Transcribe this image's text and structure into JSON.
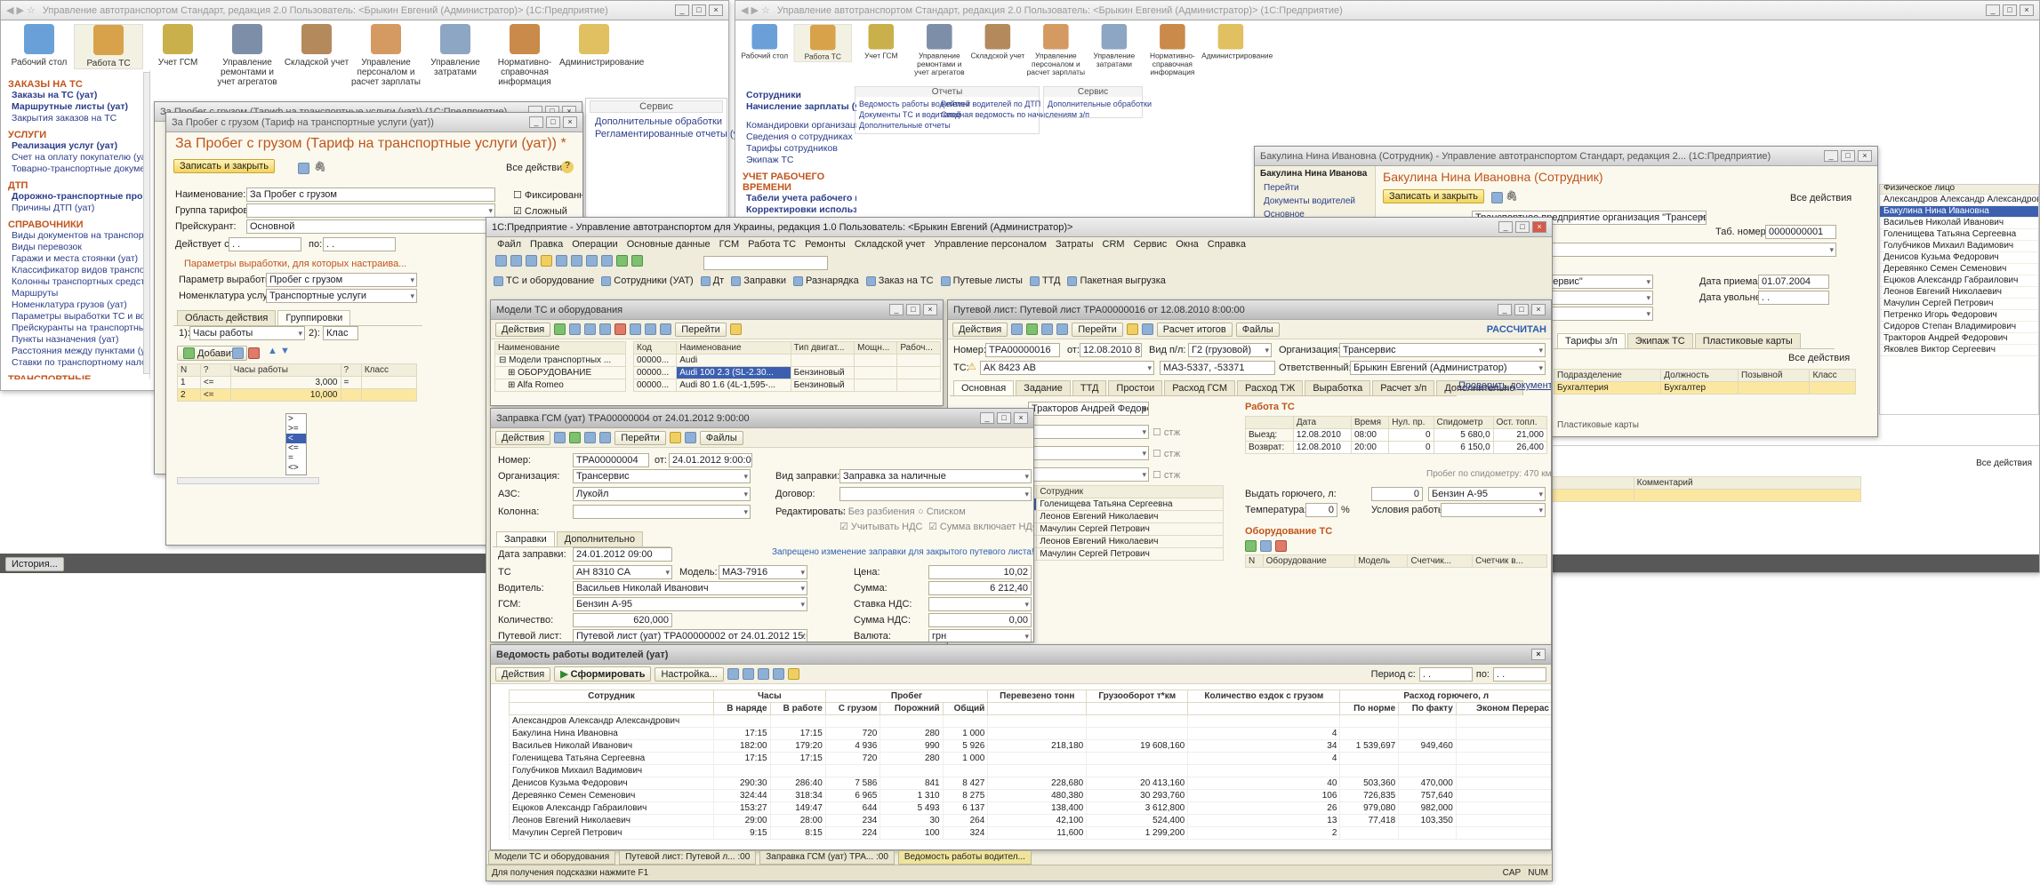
{
  "left_app": {
    "title": "Управление автотранспортом Стандарт, редакция 2.0  Пользователь: <Брыкин Евгений (Администратор)> (1С:Предприятие)",
    "sections": [
      {
        "label": "Рабочий стол",
        "icon": "desktop-icon"
      },
      {
        "label": "Работа ТС",
        "icon": "truck-icon"
      },
      {
        "label": "Учет ГСМ",
        "icon": "fuel-barrels-icon"
      },
      {
        "label": "Управление ремонтами и учет агрегатов",
        "icon": "tools-icon"
      },
      {
        "label": "Складской учет",
        "icon": "warehouse-icon"
      },
      {
        "label": "Управление персоналом и расчет зарплаты",
        "icon": "worker-icon"
      },
      {
        "label": "Управление затратами",
        "icon": "calculator-icon"
      },
      {
        "label": "Нормативно-справочная информация",
        "icon": "books-icon"
      },
      {
        "label": "Администрирование",
        "icon": "database-icon"
      }
    ],
    "nav": [
      {
        "type": "section",
        "text": "Заказы на ТС"
      },
      {
        "type": "bold",
        "text": "Заказы на ТС (уат)"
      },
      {
        "type": "bold",
        "text": "Маршрутные листы (уат)"
      },
      {
        "type": "link",
        "text": "Закрытия заказов на ТС"
      },
      {
        "type": "section",
        "text": "Услуги"
      },
      {
        "type": "bold",
        "text": "Реализация услуг (уат)"
      },
      {
        "type": "link",
        "text": "Счет на оплату покупателю (уат)"
      },
      {
        "type": "link",
        "text": "Товарно-транспортные документы (уат)"
      },
      {
        "type": "section",
        "text": "ДТП"
      },
      {
        "type": "bold",
        "text": "Дорожно-транспортные происшест..."
      },
      {
        "type": "link",
        "text": "Причины ДТП (уат)"
      },
      {
        "type": "section",
        "text": "Справочники"
      },
      {
        "type": "link",
        "text": "Виды документов на транспортные средст..."
      },
      {
        "type": "link",
        "text": "Виды перевозок"
      },
      {
        "type": "link",
        "text": "Гаражи и места стоянки (уат)"
      },
      {
        "type": "link",
        "text": "Классификатор видов транспортных средст..."
      },
      {
        "type": "link",
        "text": "Колонны транспортных средств (уат)"
      },
      {
        "type": "link",
        "text": "Маршруты"
      },
      {
        "type": "link",
        "text": "Номенклатура грузов (уат)"
      },
      {
        "type": "link",
        "text": "Параметры выработки ТС и водителей (уат)"
      },
      {
        "type": "link",
        "text": "Прейскуранты на транспортные услуги (уат)"
      },
      {
        "type": "link",
        "text": "Пункты назначения (уат)"
      },
      {
        "type": "link",
        "text": "Расстояния между пунктами (уат)"
      },
      {
        "type": "link",
        "text": "Ставки по транспортному налогу (уат)"
      },
      {
        "type": "section",
        "text": "Транспортные средства"
      },
      {
        "type": "bold",
        "text": "Транспортные средства и оборуд..."
      },
      {
        "type": "bold",
        "text": "Модели транспортных средств и о..."
      },
      {
        "type": "link",
        "text": "Документы ТС (уат)"
      }
    ],
    "history_btn": "История..."
  },
  "tariff_bg": {
    "title": "За Пробег с грузом (Тариф на транспортные услуги (уат)) (1С:Предприятие)"
  },
  "service_panel": {
    "header": "Сервис",
    "links": [
      "Дополнительные обработки",
      "Регламентированные отчеты (уат)"
    ]
  },
  "tariff": {
    "title": "За Пробег с грузом (Тариф на транспортные услуги (уат))",
    "heading": "За Пробег с грузом (Тариф на транспортные услуги (уат)) *",
    "save_close": "Записать и закрыть",
    "all_actions": "Все действия",
    "name_label": "Наименование:",
    "name_value": "За Пробег с грузом",
    "fixed": "Фиксированный",
    "complex": "Сложный",
    "group_label": "Группа тарифов:",
    "price_label": "Прейскурант:",
    "price_value": "Основной",
    "acts_label": "Действует с:",
    "acts_from": " .  .    ",
    "acts_to_label": "по:",
    "acts_to": " .  .    ",
    "params_header": "Параметры выработки, для которых настраива...",
    "param_label": "Параметр выработки:",
    "param_value": "Пробег с грузом",
    "nomen_label": "Номенклатура услуги:",
    "nomen_value": "Транспортные услуги",
    "tab1": "Область действия",
    "tab2": "Группировки",
    "row1_label": "1):",
    "row1_value": "Часы работы",
    "row2_label": "2):",
    "row2_value": "Клас",
    "add_btn": "Добавить",
    "cols": [
      "N",
      "?",
      "Часы работы",
      "?",
      "Класс"
    ],
    "rows": [
      [
        "1",
        "<=",
        "3,000",
        "="
      ],
      [
        "2",
        "<=",
        "10,000",
        ""
      ]
    ],
    "ops": [
      ">",
      ">=",
      "<",
      "<=",
      "=",
      "<>"
    ]
  },
  "right_app": {
    "title": "Управление автотранспортом Стандарт, редакция 2.0  Пользователь: <Брыкин Евгений (Администратор)> (1С:Предприятие)",
    "sections": [
      {
        "label": "Рабочий стол",
        "icon": "desktop-icon"
      },
      {
        "label": "Работа ТС",
        "icon": "truck-icon"
      },
      {
        "label": "Учет ГСМ",
        "icon": "fuel-barrels-icon"
      },
      {
        "label": "Управление ремонтами и учет агрегатов",
        "icon": "tools-icon"
      },
      {
        "label": "Складской учет",
        "icon": "warehouse-icon"
      },
      {
        "label": "Управление персоналом и расчет зарплаты",
        "icon": "worker-icon"
      },
      {
        "label": "Управление затратами",
        "icon": "calculator-icon"
      },
      {
        "label": "Нормативно-справочная информация",
        "icon": "books-icon"
      },
      {
        "label": "Администрирование",
        "icon": "database-icon"
      }
    ],
    "nav": [
      {
        "type": "bold",
        "text": "Сотрудники"
      },
      {
        "type": "bold",
        "text": "Начисление зарплаты (уат)"
      },
      {
        "type": "gap",
        "text": ""
      },
      {
        "type": "link",
        "text": "Командировки организаций"
      },
      {
        "type": "link",
        "text": "Сведения о сотрудниках"
      },
      {
        "type": "link",
        "text": "Тарифы сотрудников"
      },
      {
        "type": "link",
        "text": "Экипаж ТС"
      },
      {
        "type": "section",
        "text": "Учет рабочего времени"
      },
      {
        "type": "bold",
        "text": "Табели учета рабочего времени ..."
      },
      {
        "type": "bold",
        "text": "Корректировки использования ..."
      }
    ],
    "reports_header": "Отчеты",
    "reports": [
      "Ведомость работы водителей",
      "Рейтинг водителей по ДТП",
      "Документы ТС и водителей",
      "Сводная ведомость по начислениям з/п",
      "Дополнительные отчеты"
    ],
    "service_header": "Сервис",
    "service_links": [
      "Дополнительные обработки"
    ]
  },
  "employee": {
    "title": "Бакулина Нина Ивановна (Сотрудник) - Управление автотранспортом Стандарт, редакция 2... (1С:Предприятие)",
    "side_header": "Бакулина Нина Иванова",
    "side_links": [
      "Перейти",
      "Документы водителей",
      "Основное"
    ],
    "heading": "Бакулина Нина Ивановна (Сотрудник)",
    "save_close": "Записать и закрыть",
    "all_actions": "Все действия",
    "org_value": "Транспортное предприятие организация \"Трансервис\"",
    "tab_label": "Таб. номер:",
    "tab_value": "0000000001",
    "org2_value": "Компания \"Трансервис\"",
    "hire_label": "Дата приема:",
    "hire_value": "01.07.2004",
    "fire_label": "Дата увольнения:",
    "fire_value": " .  .    ",
    "tabs": [
      "Тарифы з/п",
      "Экипаж ТС",
      "Пластиковые карты"
    ],
    "cols": [
      "Подразделение",
      "Должность",
      "Позывной",
      "Класс"
    ],
    "row": [
      "Бухгалтерия",
      "Бухгалтер",
      "",
      ""
    ],
    "plastic_header": "Пластиковые карты",
    "plastic_cols": [
      "",
      "График работы",
      "Класс",
      "Позывной",
      "Комментарий"
    ]
  },
  "employee_list": {
    "header": "Физическое лицо",
    "names": [
      "Александров Александр Александрович",
      "Бакулина Нина Ивановна",
      "Васильев Николай Иванович",
      "Голенищева Татьяна Сергеевна",
      "Голубчиков Михаил Вадимович",
      "Денисов Кузьма Федорович",
      "Деревянко Семен Семенович",
      "Ецюков Александр Габраилович",
      "Леонов Евгений Николаевич",
      "Мачулин Сергей Петрович",
      "Петренко Игорь Федорович",
      "Сидоров Степан Владимирович",
      "Тракторов Андрей Федорович",
      "Яковлев Виктор Сергеевич"
    ],
    "selected": 1,
    "all_actions": "Все действия"
  },
  "main": {
    "title": "1С:Предприятие - Управление автотранспортом для Украины, редакция 1.0    Пользователь: <Брыкин Евгений (Администратор)>",
    "menu": [
      "Файл",
      "Правка",
      "Операции",
      "Основные данные",
      "ГСМ",
      "Работа ТС",
      "Ремонты",
      "Складской учет",
      "Управление персоналом",
      "Затраты",
      "CRM",
      "Сервис",
      "Окна",
      "Справка"
    ],
    "quick": [
      {
        "label": "ТС и оборудование",
        "icon": "truck-small-icon"
      },
      {
        "label": "Сотрудники (УАТ)",
        "icon": "people-icon"
      },
      {
        "label": "Дт",
        "icon": "debit-icon"
      },
      {
        "label": "Заправки",
        "icon": "fuel-pump-icon"
      },
      {
        "label": "Разнарядка",
        "icon": "schedule-icon"
      },
      {
        "label": "Заказ на ТС",
        "icon": "order-icon"
      },
      {
        "label": "Путевые листы",
        "icon": "waybill-icon"
      },
      {
        "label": "ТТД",
        "icon": "ttd-icon"
      },
      {
        "label": "Пакетная выгрузка",
        "icon": "export-icon"
      }
    ],
    "status_hint": "Для получения подсказки нажмите F1",
    "status_caps": "CAP",
    "status_num": "NUM",
    "taskbar": [
      "Модели ТС и оборудования",
      "Путевой лист: Путевой л... :00",
      "Заправка ГСМ (уат) ТРА... :00",
      "Ведомость работы водител..."
    ]
  },
  "models": {
    "title": "Модели ТС и оборудования",
    "actions": "Действия",
    "goto": "Перейти",
    "tree_header": "Наименование",
    "tree": [
      "Модели транспортных ...",
      "ОБОРУДОВАНИЕ",
      "Alfa Romeo"
    ],
    "cols": [
      "Код",
      "Наименование",
      "Тип двигат...",
      "Мощн...",
      "Рабоч..."
    ],
    "rows": [
      [
        "00000...",
        "Audi",
        "",
        "",
        ""
      ],
      [
        "00000...",
        "Audi 100 2.3 (SL-2.30...",
        "Бензиновый",
        "",
        ""
      ],
      [
        "00000...",
        "Audi 80 1.6 (4L-1,595-...",
        "Бензиновый",
        "",
        ""
      ]
    ]
  },
  "waybill": {
    "title": "Путевой лист: Путевой лист ТРА00000016 от 12.08.2010 8:00:00",
    "actions": "Действия",
    "goto": "Перейти",
    "calc_totals": "Расчет итогов",
    "files": "Файлы",
    "calculated": "РАССЧИТАН",
    "num_label": "Номер:",
    "num_value": "ТРА00000016",
    "date_label": "от:",
    "date_value": "12.08.2010 8:(",
    "kind_label": "Вид п/л:",
    "kind_value": "Г2 (грузовой)",
    "org_label": "Организация:",
    "org_value": "Трансервис",
    "ts_label": "ТС:",
    "ts_value": "АК 8423 АВ",
    "ts_model": "МАЗ-5337, -53371",
    "resp_label": "Ответственный:",
    "resp_value": "Брыкин Евгений (Администратор)",
    "tabs": [
      "Основная",
      "Задание",
      "ТТД",
      "Простои",
      "Расход ГСМ",
      "Расход ТЖ",
      "Выработка",
      "Расчет з/п",
      "Дополнительно"
    ],
    "check_docs": "Проверить документы",
    "driver_value": "Тракторов Андрей Федорович",
    "chk_label": "стж",
    "work_header": "Работа ТС",
    "work_cols": [
      "Дата",
      "Время",
      "Нул. пр.",
      "Спидометр",
      "Ост. топл."
    ],
    "depart_label": "Выезд:",
    "depart": [
      "12.08.2010",
      "08:00",
      "0",
      "5 680,0",
      "21,000"
    ],
    "return_label": "Возврат:",
    "return": [
      "12.08.2010",
      "20:00",
      "0",
      "6 150,0",
      "26,400"
    ],
    "odo_note": "Пробег по спидометру: 470 км.",
    "fuel_label": "Выдать горючего, л:",
    "fuel_value": "0",
    "fuel_type": "Бензин А-95",
    "temp_label": "Температура:",
    "temp_value": "0",
    "temp_unit": "%",
    "cond_label": "Условия работы:",
    "employees_header": "Сотрудник",
    "employees": [
      "Голенищева Татьяна Сергеевна",
      "Леонов Евгений Николаевич",
      "Мачулин Сергей Петрович",
      "Леонов Евгений Николаевич",
      "Мачулин Сергей Петрович"
    ],
    "equip_header": "Оборудование ТС",
    "equip_cols": [
      "N",
      "Оборудование",
      "Модель",
      "Счетчик...",
      "Счетчик в..."
    ]
  },
  "fuel": {
    "title": "Заправка ГСМ (уат) ТРА00000004 от 24.01.2012 9:00:00",
    "actions": "Действия",
    "goto": "Перейти",
    "files": "Файлы",
    "num_label": "Номер:",
    "num_value": "ТРА00000004",
    "date_label": "от:",
    "date_value": "24.01.2012 9:00:00",
    "kind_label": "Вид заправки:",
    "kind_value": "Заправка за наличные",
    "org_label": "Организация:",
    "org_value": "Трансервис",
    "contract_label": "Договор:",
    "azs_label": "АЗС:",
    "azs_value": "Лукойл",
    "edit_label": "Редактировать:",
    "edit_opt1": "Без разбиения",
    "edit_opt2": "Списком",
    "column_label": "Колонна:",
    "vat_opt1": "Учитывать НДС",
    "vat_opt2": "Сумма включает НДС",
    "tabs": [
      "Заправки",
      "Дополнительно"
    ],
    "warning": "Запрещено изменение заправки для закрытого путевого листа!",
    "refuel_label": "Дата заправки:",
    "refuel_value": "24.01.2012 09:00",
    "ts_label": "ТС",
    "ts_value": "АН 8310 СА",
    "model_label": "Модель:",
    "model_value": "МАЗ-7916",
    "price_label": "Цена:",
    "price_value": "10,02",
    "driver_label": "Водитель:",
    "driver_value": "Васильев Николай Иванович",
    "sum_label": "Сумма:",
    "sum_value": "6 212,40",
    "gsm_label": "ГСМ:",
    "gsm_value": "Бензин А-95",
    "vatrate_label": "Ставка НДС:",
    "qty_label": "Количество:",
    "qty_value": "620,000",
    "vatsum_label": "Сумма НДС:",
    "vatsum_value": "0,00",
    "waybill_label": "Путевой лист:",
    "waybill_value": "Путевой лист (уат) ТРА00000002 от 24.01.2012 15:02:5",
    "currency_label": "Валюта:",
    "currency_value": "грн"
  },
  "report": {
    "title": "Ведомость работы водителей (уат)",
    "actions": "Действия",
    "generate": "Сформировать",
    "settings": "Настройка...",
    "period_label": "Период с:",
    "period_from": " .  .    ",
    "period_to_label": "по:",
    "period_to": " .  .    ",
    "head_groups": [
      "Сотрудник",
      "Часы",
      "Пробег",
      "Перевезено тонн",
      "Грузооборот т*км",
      "Количество ездок с грузом",
      "Расход горючего, л"
    ],
    "sub_cols": [
      "",
      "В наряде",
      "В работе",
      "С грузом",
      "Порожний",
      "Общий",
      "",
      "",
      "",
      "По норме",
      "По факту",
      "Эконом Перерас"
    ],
    "rows": [
      [
        "Александров Александр Александрович",
        "",
        "",
        "",
        "",
        "",
        "",
        "",
        "",
        "",
        "",
        ""
      ],
      [
        "Бакулина Нина Ивановна",
        "",
        "",
        "",
        "",
        "",
        "",
        "",
        "",
        "",
        "",
        ""
      ],
      [
        "Васильев Николай Иванович",
        "182:00",
        "179:20",
        "4 936",
        "990",
        "5 926",
        "218,180",
        "19 608,160",
        "34",
        "1 539,697",
        "949,460",
        ""
      ],
      [
        "Голенищева Татьяна Сергеевна",
        "17:15",
        "17:15",
        "720",
        "280",
        "1 000",
        "",
        "",
        "4",
        "",
        "",
        ""
      ],
      [
        "Голубчиков Михаил Вадимович",
        "",
        "",
        "",
        "",
        "",
        "",
        "",
        "",
        "",
        "",
        ""
      ],
      [
        "Денисов Кузьма Федорович",
        "290:30",
        "286:40",
        "7 586",
        "841",
        "8 427",
        "228,680",
        "20 413,160",
        "40",
        "503,360",
        "470,000",
        ""
      ],
      [
        "Деревянко Семен Семенович",
        "324:44",
        "318:34",
        "6 965",
        "1 310",
        "8 275",
        "480,380",
        "30 293,760",
        "106",
        "726,835",
        "757,640",
        ""
      ],
      [
        "Ецюков Александр Габраилович",
        "153:27",
        "149:47",
        "644",
        "5 493",
        "6 137",
        "138,400",
        "3 612,800",
        "26",
        "979,080",
        "982,000",
        ""
      ],
      [
        "Леонов Евгений Николаевич",
        "29:00",
        "28:00",
        "234",
        "30",
        "264",
        "42,100",
        "524,400",
        "13",
        "77,418",
        "103,350",
        ""
      ],
      [
        "Мачулин Сергей Петрович",
        "9:15",
        "8:15",
        "224",
        "100",
        "324",
        "11,600",
        "1 299,200",
        "2",
        "",
        "",
        ""
      ]
    ],
    "row2_hours": [
      "17:15",
      "17:15",
      "720",
      "280",
      "1 000",
      "",
      "",
      "4"
    ]
  }
}
